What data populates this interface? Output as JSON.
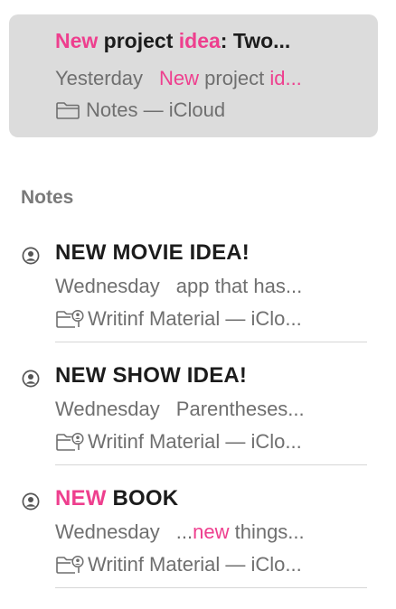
{
  "pinned_result": {
    "title_parts": [
      {
        "text": "New",
        "highlight": true
      },
      {
        "text": " project ",
        "highlight": false
      },
      {
        "text": "idea",
        "highlight": true
      },
      {
        "text": ": Two...",
        "highlight": false
      }
    ],
    "date": "Yesterday",
    "snippet_parts": [
      {
        "text": "New",
        "highlight": true
      },
      {
        "text": " project ",
        "highlight": false
      },
      {
        "text": "id...",
        "highlight": true
      }
    ],
    "folder": "Notes — iCloud",
    "folder_icon": "folder-icon"
  },
  "section": {
    "header": "Notes"
  },
  "notes": [
    {
      "title_parts": [
        {
          "text": "NEW MOVIE IDEA!",
          "highlight": false
        }
      ],
      "date": "Wednesday",
      "snippet_parts": [
        {
          "text": "app that has...",
          "highlight": false
        }
      ],
      "folder": "Writinf Material — iClo...",
      "owner_icon": "person-circle-icon",
      "folder_icon": "shared-folder-icon"
    },
    {
      "title_parts": [
        {
          "text": "NEW SHOW IDEA!",
          "highlight": false
        }
      ],
      "date": "Wednesday",
      "snippet_parts": [
        {
          "text": "Parentheses...",
          "highlight": false
        }
      ],
      "folder": "Writinf Material — iClo...",
      "owner_icon": "person-circle-icon",
      "folder_icon": "shared-folder-icon"
    },
    {
      "title_parts": [
        {
          "text": "NEW",
          "highlight": true
        },
        {
          "text": " BOOK",
          "highlight": false
        }
      ],
      "date": "Wednesday",
      "snippet_parts": [
        {
          "text": "...",
          "highlight": false
        },
        {
          "text": "new",
          "highlight": true
        },
        {
          "text": " things...",
          "highlight": false
        }
      ],
      "folder": "Writinf Material — iClo...",
      "owner_icon": "person-circle-icon",
      "folder_icon": "shared-folder-icon"
    }
  ],
  "colors": {
    "highlight": "#ee3f8e",
    "selected_background": "#dcdcdc",
    "secondary_text": "#6f6f6f"
  }
}
